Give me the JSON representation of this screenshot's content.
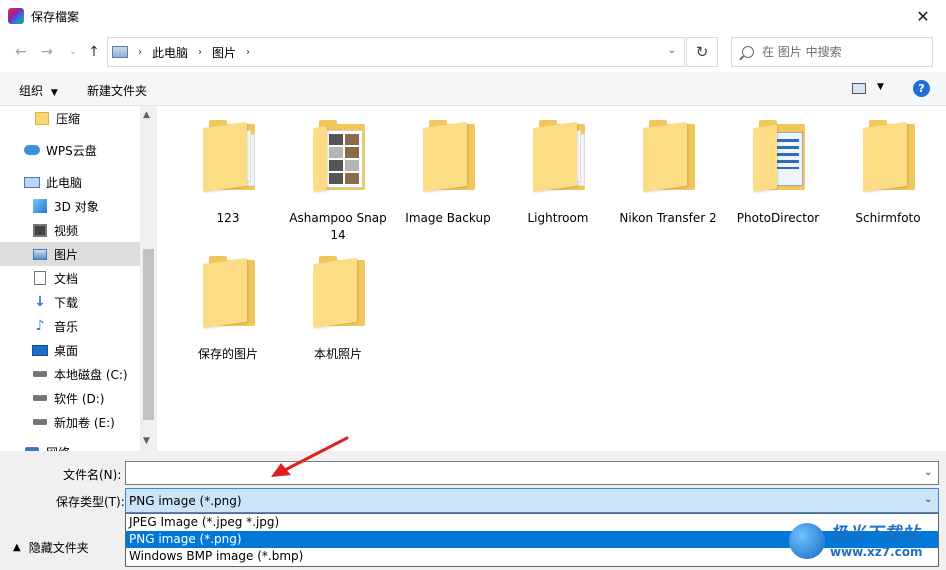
{
  "window": {
    "title": "保存檔案"
  },
  "nav": {
    "breadcrumb": [
      "此电脑",
      "图片"
    ],
    "search_placeholder": "在 图片 中搜索"
  },
  "toolbar": {
    "organize_label": "组织",
    "new_folder_label": "新建文件夹",
    "help_label": "?"
  },
  "sidebar": {
    "items": [
      {
        "label": "压缩",
        "icon": "folder-icon"
      },
      {
        "label": "WPS云盘",
        "icon": "cloud-icon"
      },
      {
        "label": "此电脑",
        "icon": "pc-icon"
      },
      {
        "label": "3D 对象",
        "icon": "cube-icon"
      },
      {
        "label": "视频",
        "icon": "video-icon"
      },
      {
        "label": "图片",
        "icon": "pictures-icon",
        "selected": true
      },
      {
        "label": "文档",
        "icon": "document-icon"
      },
      {
        "label": "下载",
        "icon": "download-icon"
      },
      {
        "label": "音乐",
        "icon": "music-icon"
      },
      {
        "label": "桌面",
        "icon": "desktop-icon"
      },
      {
        "label": "本地磁盘 (C:)",
        "icon": "drive-icon"
      },
      {
        "label": "软件 (D:)",
        "icon": "drive-icon"
      },
      {
        "label": "新加卷 (E:)",
        "icon": "drive-icon"
      },
      {
        "label": "网络",
        "icon": "network-icon"
      }
    ]
  },
  "folders": [
    {
      "name": "123",
      "style": "papers"
    },
    {
      "name": "Ashampoo Snap 14",
      "style": "photos"
    },
    {
      "name": "Image Backup",
      "style": "plain"
    },
    {
      "name": "Lightroom",
      "style": "papers"
    },
    {
      "name": "Nikon Transfer 2",
      "style": "plain"
    },
    {
      "name": "PhotoDirector",
      "style": "docs"
    },
    {
      "name": "Schirmfoto",
      "style": "plain"
    },
    {
      "name": "保存的图片",
      "style": "plain"
    },
    {
      "name": "本机照片",
      "style": "plain"
    }
  ],
  "form": {
    "filename_label": "文件名(N):",
    "filename_value": "",
    "filetype_label": "保存类型(T):",
    "filetype_value": "PNG image (*.png)",
    "filetype_options": [
      "JPEG Image (*.jpeg *.jpg)",
      "PNG image (*.png)",
      "Windows BMP image (*.bmp)"
    ],
    "hide_folders_label": "隐藏文件夹"
  },
  "watermark": {
    "text": "极光下载站",
    "url": "www.xz7.com"
  },
  "colors": {
    "accent": "#0078d7",
    "selection_bg": "#cce4f7",
    "annotation_arrow": "#e02020"
  }
}
